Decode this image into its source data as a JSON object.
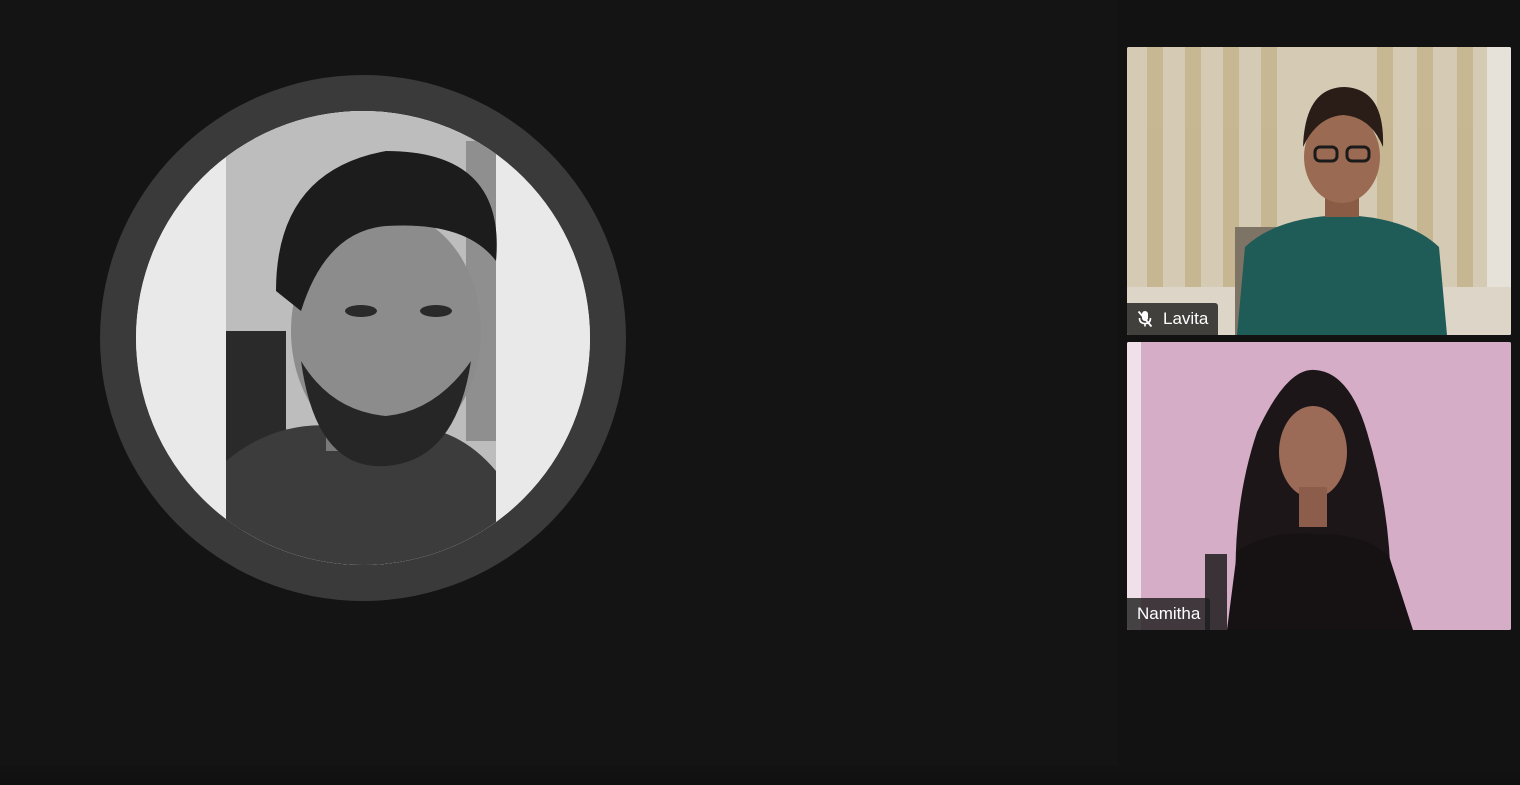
{
  "meeting": {
    "presenter": {
      "avatar_label": "presenter-avatar"
    },
    "participants": [
      {
        "name": "Lavita",
        "muted": true,
        "mic_icon": "mic-off-icon"
      },
      {
        "name": "Namitha",
        "muted": false
      }
    ]
  },
  "colors": {
    "background": "#141414",
    "avatar_ring": "#3a3a3a",
    "name_tag_bg": "#1e1e1e",
    "name_tag_text": "#ffffff"
  }
}
